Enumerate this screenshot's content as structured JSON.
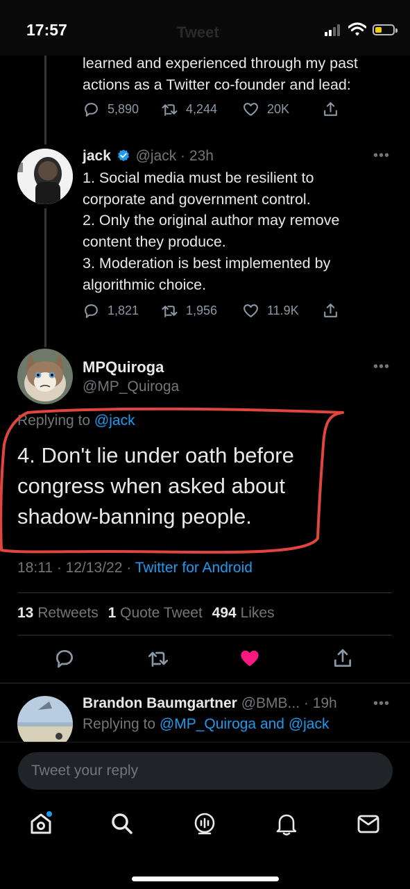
{
  "status_bar": {
    "time": "17:57",
    "screen_title": "Tweet"
  },
  "tweet_1": {
    "text_lines": [
      "learned and experienced through my past",
      "actions as a Twitter co-founder and lead:"
    ],
    "replies": "5,890",
    "retweets": "4,244",
    "likes": "20K"
  },
  "tweet_2": {
    "name": "jack",
    "handle_time": "@jack · 23h",
    "text_lines": [
      "1. Social media must be resilient to",
      "corporate and government control.",
      "2. Only the original author may remove",
      "content they produce.",
      "3. Moderation is best implemented by",
      "algorithmic choice."
    ],
    "replies": "1,821",
    "retweets": "1,956",
    "likes": "11.9K",
    "more": "•••"
  },
  "main_tweet": {
    "name": "MPQuiroga",
    "handle": "@MP_Quiroga",
    "replying_prefix": "Replying to ",
    "replying_to": "@jack",
    "text_lines": [
      "4. Don't lie under oath before",
      "congress when asked about",
      "shadow-banning people."
    ],
    "time": "18:11 · 12/13/22 · ",
    "source": "Twitter for Android",
    "retweets_count": "13",
    "retweets_label": "Retweets",
    "quotes_count": "1",
    "quotes_label": "Quote Tweet",
    "likes_count": "494",
    "likes_label": "Likes",
    "more": "•••",
    "like_color": "#f91880"
  },
  "reply": {
    "name": "Brandon Baumgartner",
    "handle_time": "@BMB... · 19h",
    "replying_prefix": "Replying to ",
    "replying_to": "@MP_Quiroga and @jack",
    "more": "•••"
  },
  "composer": {
    "placeholder": "Tweet your reply"
  },
  "tab_bar": {
    "icons": [
      "home-icon",
      "search-icon",
      "spaces-icon",
      "notifications-icon",
      "messages-icon"
    ]
  },
  "colors": {
    "accent": "#1d9bf0",
    "annotation": "#e0463f"
  }
}
